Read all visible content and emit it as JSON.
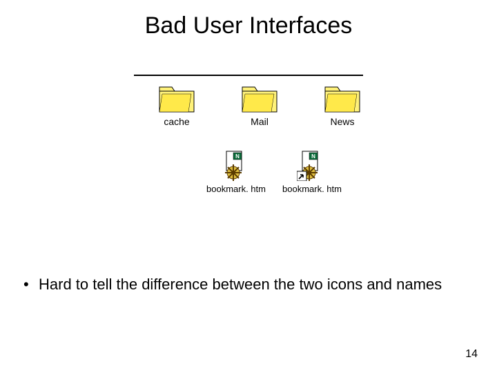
{
  "title": "Bad User Interfaces",
  "folders": [
    {
      "label": "cache"
    },
    {
      "label": "Mail"
    },
    {
      "label": "News"
    }
  ],
  "files": [
    {
      "label": "bookmark. htm",
      "shortcut": false
    },
    {
      "label": "bookmark. htm",
      "shortcut": true
    }
  ],
  "bullet": {
    "marker": "•",
    "text": "Hard to tell the difference between the two icons and names"
  },
  "page_number": "14",
  "icon_names": {
    "folder": "folder-icon",
    "bookmark": "bookmark-file-icon",
    "shortcut_overlay": "shortcut-arrow-icon"
  }
}
